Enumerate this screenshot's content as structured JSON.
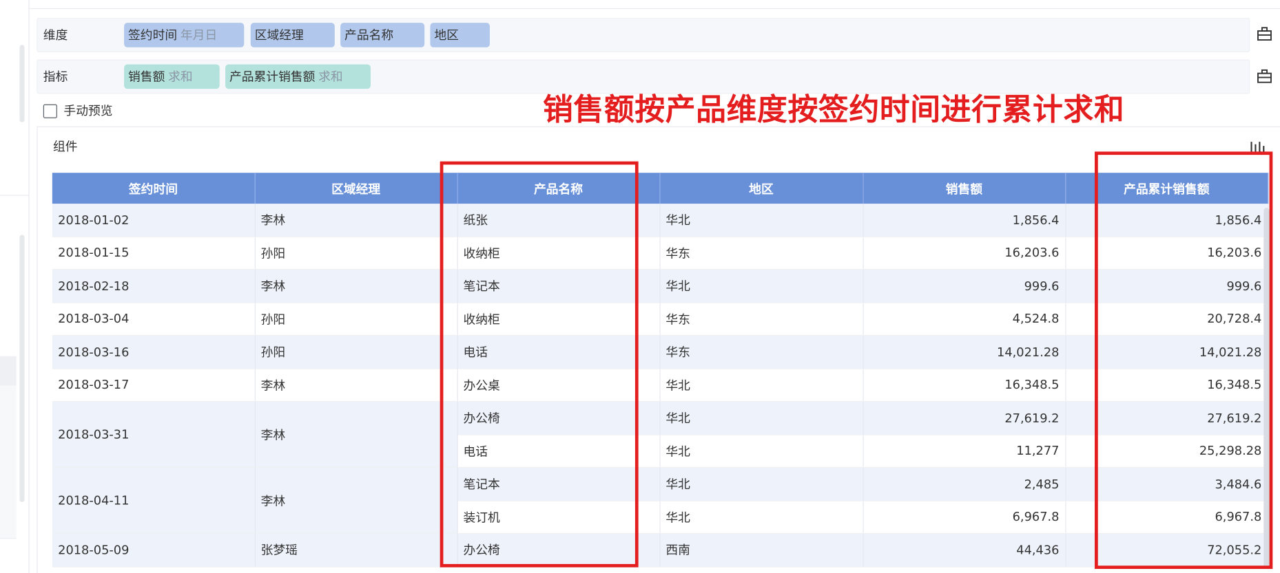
{
  "dimension_row": {
    "label": "维度",
    "chips": [
      {
        "name": "签约时间",
        "suffix": "年月日"
      },
      {
        "name": "区域经理",
        "suffix": ""
      },
      {
        "name": "产品名称",
        "suffix": ""
      },
      {
        "name": "地区",
        "suffix": ""
      }
    ]
  },
  "measure_row": {
    "label": "指标",
    "chips": [
      {
        "name": "销售额",
        "suffix": "求和"
      },
      {
        "name": "产品累计销售额",
        "suffix": "求和"
      }
    ]
  },
  "manual_preview": {
    "label": "手动预览",
    "checked": false
  },
  "annotation": {
    "text": "销售额按产品维度按签约时间进行累计求和",
    "color": "#e41e1e"
  },
  "component": {
    "title": "组件"
  },
  "table": {
    "columns": [
      "签约时间",
      "区域经理",
      "产品名称",
      "地区",
      "销售额",
      "产品累计销售额"
    ],
    "rows": [
      {
        "date": "2018-01-02",
        "manager": "李林",
        "product": "纸张",
        "region": "华北",
        "sales": "1,856.4",
        "cum": "1,856.4"
      },
      {
        "date": "2018-01-15",
        "manager": "孙阳",
        "product": "收纳柜",
        "region": "华东",
        "sales": "16,203.6",
        "cum": "16,203.6"
      },
      {
        "date": "2018-02-18",
        "manager": "李林",
        "product": "笔记本",
        "region": "华北",
        "sales": "999.6",
        "cum": "999.6"
      },
      {
        "date": "2018-03-04",
        "manager": "孙阳",
        "product": "收纳柜",
        "region": "华东",
        "sales": "4,524.8",
        "cum": "20,728.4"
      },
      {
        "date": "2018-03-16",
        "manager": "孙阳",
        "product": "电话",
        "region": "华东",
        "sales": "14,021.28",
        "cum": "14,021.28"
      },
      {
        "date": "2018-03-17",
        "manager": "李林",
        "product": "办公桌",
        "region": "华北",
        "sales": "16,348.5",
        "cum": "16,348.5"
      },
      {
        "date": "2018-03-31",
        "manager": "李林",
        "product": "办公椅",
        "region": "华北",
        "sales": "27,619.2",
        "cum": "27,619.2"
      },
      {
        "date": "",
        "manager": "",
        "product": "电话",
        "region": "华北",
        "sales": "11,277",
        "cum": "25,298.28"
      },
      {
        "date": "2018-04-11",
        "manager": "李林",
        "product": "笔记本",
        "region": "华北",
        "sales": "2,485",
        "cum": "3,484.6"
      },
      {
        "date": "",
        "manager": "",
        "product": "装订机",
        "region": "华北",
        "sales": "6,967.8",
        "cum": "6,967.8"
      },
      {
        "date": "2018-05-09",
        "manager": "张梦瑶",
        "product": "办公椅",
        "region": "西南",
        "sales": "44,436",
        "cum": "72,055.2"
      }
    ]
  },
  "colors": {
    "header_bg": "#6790d8",
    "dimension_chip": "#b1c8ec",
    "measure_chip": "#b3e2dc",
    "stripe": "#eef3fb",
    "highlight": "#e41e1e"
  },
  "icons": [
    "toolbox-icon",
    "toolbox-icon",
    "chart-switch-icon"
  ]
}
